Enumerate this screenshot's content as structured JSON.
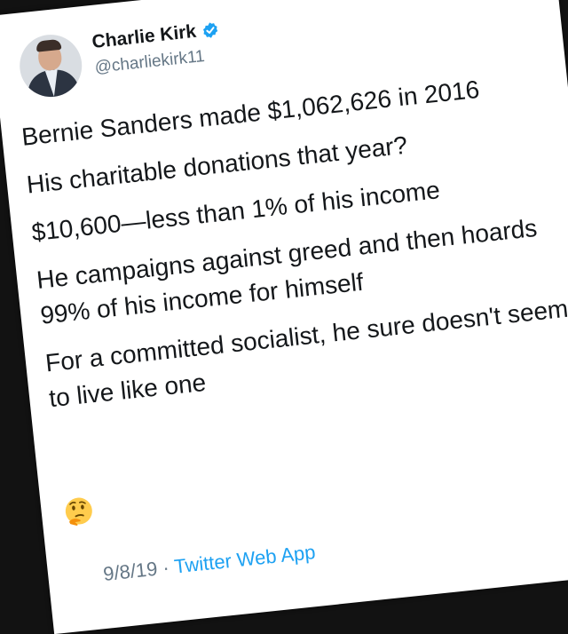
{
  "tweet": {
    "author": {
      "display_name": "Charlie Kirk",
      "handle": "@charliekirk11",
      "verified": true
    },
    "lines": [
      "Bernie Sanders made $1,062,626 in 2016",
      "His charitable donations that year?",
      "$10,600—less than 1% of his income",
      "He campaigns against greed and then hoards 99% of his income for himself",
      "For a committed socialist, he sure doesn't seem to live like one"
    ],
    "emoji": "thinking-face-icon",
    "date_partial": "9/8/19",
    "separator": "·",
    "source": "Twitter Web App"
  },
  "colors": {
    "verified_blue": "#1da1f2",
    "text": "#14171a",
    "muted": "#657786",
    "link": "#1da1f2"
  }
}
